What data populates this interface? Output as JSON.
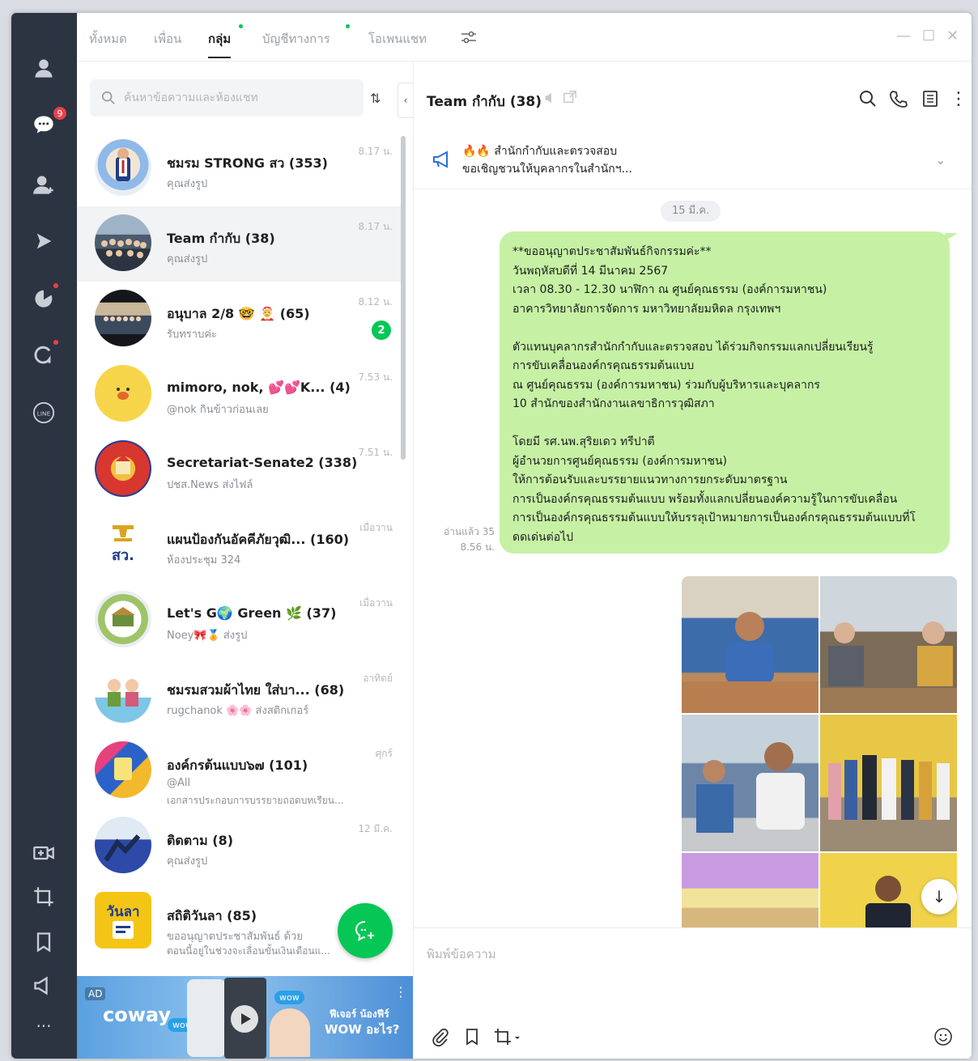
{
  "colors": {
    "rail": "#2d3441",
    "accent_green": "#06c755",
    "bubble": "#c6f1a4",
    "badge_red": "#e8414b"
  },
  "rail": {
    "chat_badge": "9",
    "line_label": "LINE"
  },
  "tabs": [
    {
      "label": "ทั้งหมด"
    },
    {
      "label": "เพื่อน"
    },
    {
      "label": "กลุ่ม"
    },
    {
      "label": "บัญชีทางการ"
    },
    {
      "label": "โอเพนแชท"
    }
  ],
  "search": {
    "placeholder": "ค้นหาข้อความและห้องแชท"
  },
  "chats": [
    {
      "name": "ชมรม STRONG สว (353)",
      "preview": "คุณส่งรูป",
      "time": "8.17 น."
    },
    {
      "name": "Team กำกับ (38)",
      "preview": "คุณส่งรูป",
      "time": "8.17 น."
    },
    {
      "name": "อนุบาล 2/8 🤓 🤶 (65)",
      "preview": "รับทราบค่ะ",
      "time": "8.12 น.",
      "unread": "2"
    },
    {
      "name": "mimoro, nok, 💕💕K...  (4)",
      "preview": "@nok กินข้าวก่อนเลย",
      "time": "7.53 น."
    },
    {
      "name": "Secretariat-Senate2 (338)",
      "preview": "ปชส.News ส่งไฟล์",
      "time": "7.51 น."
    },
    {
      "name": "แผนป้องกันอัคคีภัยวุฒิ... (160)",
      "preview": "ห้องประชุม 324",
      "time": "เมื่อวาน"
    },
    {
      "name": "Let's G🌍 Green 🌿 (37)",
      "preview": "Noey🎀🏅 ส่งรูป",
      "time": "เมื่อวาน"
    },
    {
      "name": "ชมรมสวมผ้าไทย ใส่บา... (68)",
      "preview": "rugchanok 🌸🌸 ส่งสติกเกอร์",
      "time": "อาทิตย์"
    },
    {
      "name": "องค์กรต้นแบบ๖๗ (101)",
      "preview": "@All",
      "preview2": "เอกสารประกอบการบรรยายถอดบทเรียน...",
      "time": "ศุกร์"
    },
    {
      "name": "ติดตาม (8)",
      "preview": "คุณส่งรูป",
      "time": "12 มี.ค."
    },
    {
      "name": "สถิติวันลา (85)",
      "preview": "ขออนุญาตประชาสัมพันธ์ ด้วย",
      "preview2": "ตอนนี้อยู่ในช่วงจะเลื่อนขั้นเงินเดือนแ...",
      "time": ""
    }
  ],
  "ad": {
    "tag": "AD",
    "brand": "coway",
    "wow": "wow",
    "tagline1": "ฟีเจอร์ น้องฟีร์",
    "tagline2": "WOW อะไร?"
  },
  "chat": {
    "title": "Team กำกับ (38)",
    "announcement_line1": "🔥🔥 สำนักกำกับและตรวจสอบ",
    "announcement_line2": "ขอเชิญชวนให้บุคลากรในสำนักฯ...",
    "date_chip": "15 มี.ค.",
    "read_line1": "อ่านแล้ว 35",
    "read_line2": "8.56 น.",
    "bubble_lines": [
      "**ขออนุญาตประชาสัมพันธ์กิจกรรมค่ะ**",
      "วันพฤหัสบดีที่ 14 มีนาคม 2567",
      "เวลา 08.30 - 12.30 นาฬิกา ณ ศูนย์คุณธรรม (องค์การมหาชน)",
      "อาคารวิทยาลัยการจัดการ มหาวิทยาลัยมหิดล กรุงเทพฯ",
      "",
      "ตัวแทนบุคลากรสำนักกำกับและตรวจสอบ ได้ร่วมกิจกรรมแลกเปลี่ยนเรียนรู้",
      "การขับเคลื่อนองค์กรคุณธรรมต้นแบบ",
      "ณ ศูนย์คุณธรรม (องค์การมหาชน)  ร่วมกับผู้บริหารและบุคลากร",
      "10 สำนักของสำนักงานเลขาธิการวุฒิสภา",
      "",
      "โดยมี รศ.นพ.สุริยเดว ทรีปาตี",
      "ผู้อำนวยการศูนย์คุณธรรม (องค์การมหาชน)",
      "ให้การต้อนรับและบรรยายแนวทางการยกระดับมาตรฐาน",
      "การเป็นองค์กรคุณธรรมต้นแบบ พร้อมทั้งแลกเปลี่ยนองค์ความรู้ในการขับเคลื่อน",
      "การเป็นองค์กรคุณธรรมต้นแบบให้บรรลุเป้าหมายการเป็นองค์กรคุณธรรมต้นแบบที่โ",
      "ดดเด่นต่อไป"
    ],
    "input_placeholder": "พิมพ์ข้อความ"
  }
}
